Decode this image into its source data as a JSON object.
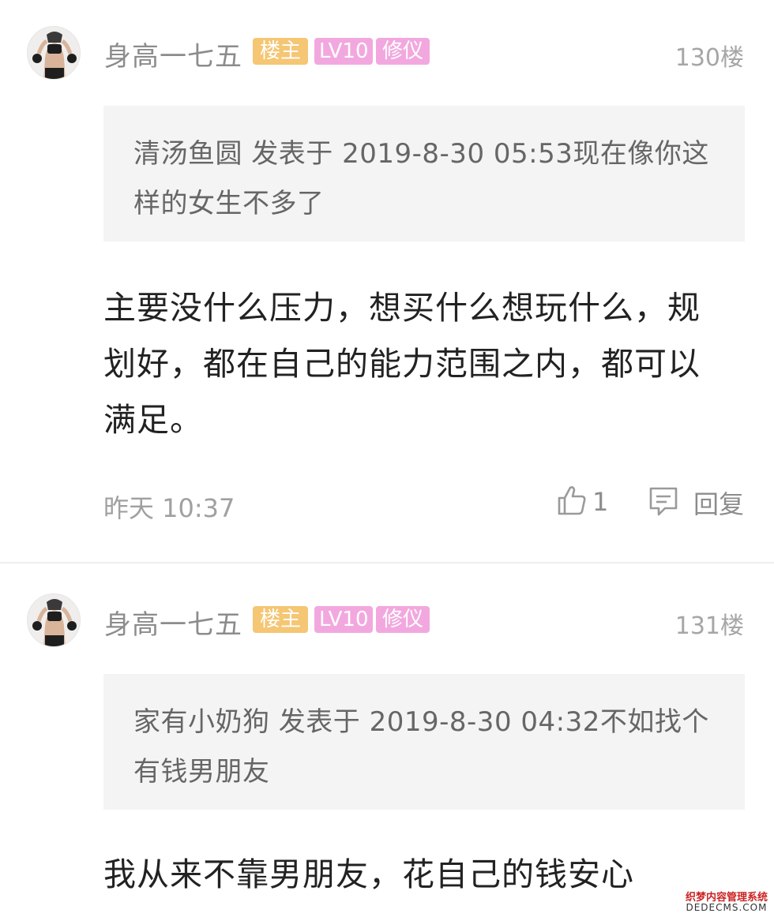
{
  "posts": [
    {
      "username": "身高一七五",
      "badges": {
        "owner": "楼主",
        "level": "LV10",
        "title": "修仪"
      },
      "floor": "130楼",
      "quote": "清汤鱼圆 发表于 2019-8-30 05:53现在像你这样的女生不多了",
      "body": "主要没什么压力，想买什么想玩什么，规划好，都在自己的能力范围之内，都可以满足。",
      "time": "昨天 10:37",
      "likes": "1",
      "reply_label": "回复"
    },
    {
      "username": "身高一七五",
      "badges": {
        "owner": "楼主",
        "level": "LV10",
        "title": "修仪"
      },
      "floor": "131楼",
      "quote": "家有小奶狗 发表于 2019-8-30 04:32不如找个有钱男朋友",
      "body": "我从来不靠男朋友，花自己的钱安心"
    }
  ],
  "icons": {
    "like": "thumbs-up-icon",
    "reply": "comment-icon"
  },
  "watermark": {
    "line1": "织梦内容管理系统",
    "line2": "DEDECMS.COM"
  },
  "colors": {
    "owner_badge": "#f5c673",
    "level_badge": "#f2a8df",
    "quote_bg": "#f4f4f4",
    "muted_text": "#a0a0a0"
  }
}
